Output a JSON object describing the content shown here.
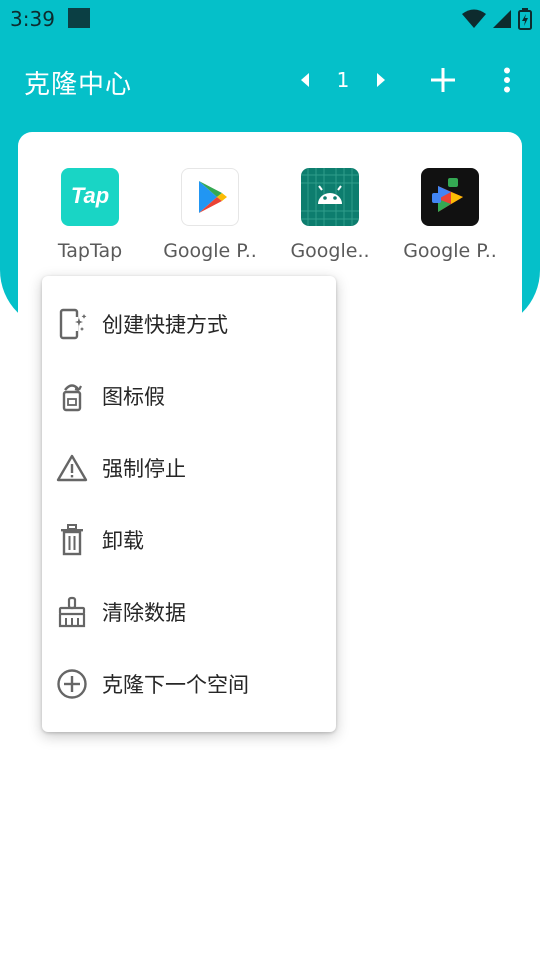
{
  "status": {
    "time": "3:39"
  },
  "app_bar": {
    "title": "克隆中心",
    "page_number": "1",
    "colors": {
      "bar": "#05c0c9",
      "text": "#ffffff"
    }
  },
  "apps": [
    {
      "label": "TapTap",
      "icon": "taptap-app-icon",
      "icon_text": "Tap"
    },
    {
      "label": "Google P..",
      "icon": "google-play-store-icon"
    },
    {
      "label": "Google..",
      "icon": "android-system-icon"
    },
    {
      "label": "Google P..",
      "icon": "google-play-services-icon"
    }
  ],
  "context_menu": {
    "items": [
      {
        "label": "创建快捷方式",
        "icon": "shortcut-icon"
      },
      {
        "label": "图标假",
        "icon": "app-disguise-icon"
      },
      {
        "label": "强制停止",
        "icon": "warning-icon"
      },
      {
        "label": "卸载",
        "icon": "trash-icon"
      },
      {
        "label": "清除数据",
        "icon": "broom-icon"
      },
      {
        "label": "克隆下一个空间",
        "icon": "add-circle-icon"
      }
    ]
  }
}
